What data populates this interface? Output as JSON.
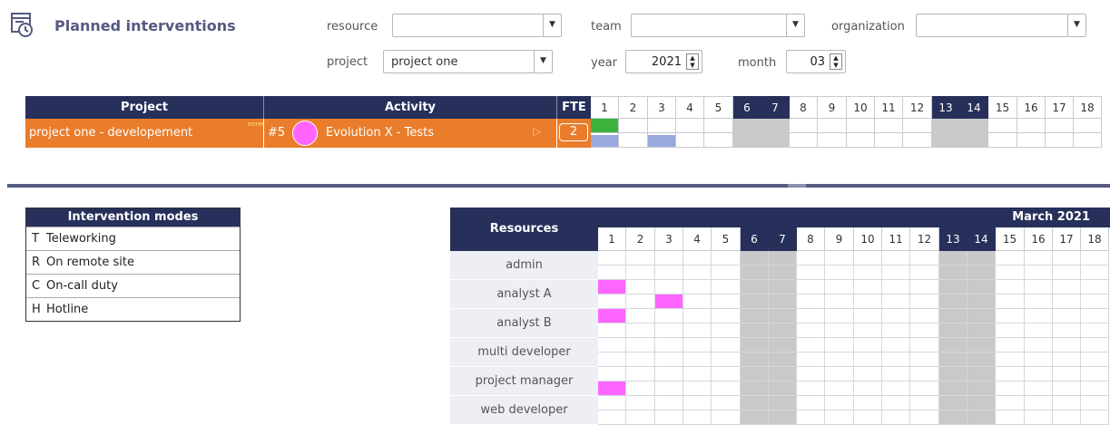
{
  "header": {
    "title": "Planned interventions",
    "icon": "calendar-clock-icon"
  },
  "filters": {
    "resource_label": "resource",
    "resource_value": "",
    "team_label": "team",
    "team_value": "",
    "organization_label": "organization",
    "organization_value": "",
    "project_label": "project",
    "project_value": "project one",
    "year_label": "year",
    "year_value": "2021",
    "month_label": "month",
    "month_value": "03"
  },
  "planning": {
    "col_project": "Project",
    "col_activity": "Activity",
    "col_fte": "FTE",
    "days": [
      "1",
      "2",
      "3",
      "4",
      "5",
      "6",
      "7",
      "8",
      "9",
      "10",
      "11",
      "12",
      "13",
      "14",
      "15",
      "16",
      "17",
      "18"
    ],
    "weekend_days": [
      "6",
      "7",
      "13",
      "14"
    ],
    "row": {
      "project": "project one - developement",
      "badge": "enregistré",
      "number": "#5",
      "activity": "Evolution X - Tests",
      "fte": "2",
      "activity_color": "#ff66ff",
      "top_marks": [
        {
          "day": "1",
          "color": "#3cb43c"
        }
      ],
      "bottom_marks": [
        {
          "day": "1",
          "color": "#9aa9dd"
        },
        {
          "day": "3",
          "color": "#9aa9dd"
        }
      ]
    }
  },
  "modes": {
    "title": "Intervention modes",
    "items": [
      {
        "code": "T",
        "name": "Teleworking"
      },
      {
        "code": "R",
        "name": "On remote site"
      },
      {
        "code": "C",
        "name": "On-call duty"
      },
      {
        "code": "H",
        "name": "Hotline"
      }
    ]
  },
  "resources": {
    "title": "Resources",
    "month": "March 2021",
    "days": [
      "1",
      "2",
      "3",
      "4",
      "5",
      "6",
      "7",
      "8",
      "9",
      "10",
      "11",
      "12",
      "13",
      "14",
      "15",
      "16",
      "17",
      "18"
    ],
    "weekend_days": [
      "6",
      "7",
      "13",
      "14"
    ],
    "mark_color": "#ff66ff",
    "rows": [
      {
        "name": "admin",
        "marks": []
      },
      {
        "name": "analyst A",
        "marks": [
          {
            "day": "1",
            "half": "top"
          },
          {
            "day": "3",
            "half": "bottom"
          }
        ]
      },
      {
        "name": "analyst B",
        "marks": [
          {
            "day": "1",
            "half": "top"
          }
        ]
      },
      {
        "name": "multi developer",
        "marks": []
      },
      {
        "name": "project manager",
        "marks": [
          {
            "day": "1",
            "half": "bottom"
          }
        ]
      },
      {
        "name": "web developer",
        "marks": []
      }
    ]
  }
}
